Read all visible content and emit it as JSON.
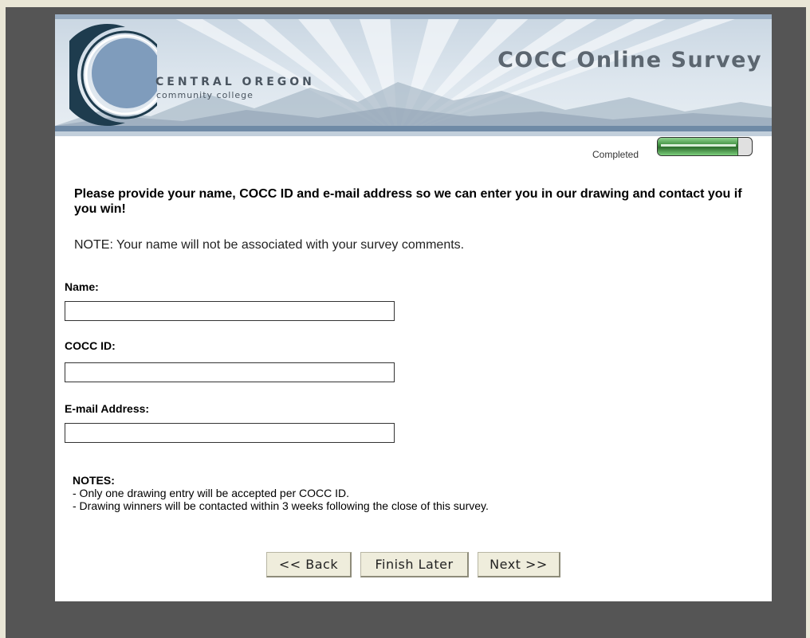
{
  "header": {
    "logo_line1": "CENTRAL OREGON",
    "logo_line2": "community college",
    "survey_title": "COCC Online Survey"
  },
  "progress": {
    "label": "Completed",
    "fraction": 0.85
  },
  "intro": {
    "text": "Please provide your name, COCC ID and e-mail address so we can enter you in our drawing and contact you if you win!",
    "note": "NOTE: Your name will not be associated with your survey comments."
  },
  "form": {
    "name_label": "Name:",
    "name_value": "",
    "id_label": "COCC ID:",
    "id_value": "",
    "email_label": "E-mail Address:",
    "email_value": ""
  },
  "notes": {
    "title": "NOTES:",
    "items": [
      "- Only one drawing entry will be accepted per COCC ID.",
      "- Drawing winners will be contacted within 3 weeks following the close of this survey."
    ]
  },
  "buttons": {
    "back": "<< Back",
    "finish_later": "Finish Later",
    "next": "Next >>"
  },
  "colors": {
    "outer_bg": "#555555",
    "page_bg": "#ffffff",
    "banner_bar": "#6f8aa6",
    "progress_green": "#3a8a3a",
    "button_bg": "#efeddc"
  }
}
